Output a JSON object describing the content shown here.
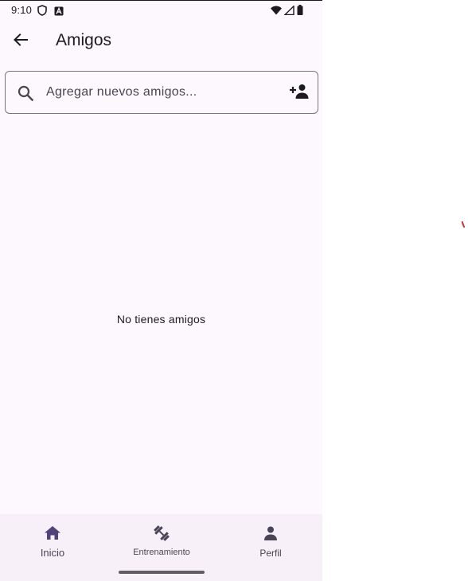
{
  "status_bar": {
    "time": "9:10",
    "left_icons": [
      "shield-icon",
      "a-badge-icon"
    ],
    "right_icons": [
      "wifi-icon",
      "signal-icon",
      "battery-icon"
    ]
  },
  "app_bar": {
    "title": "Amigos",
    "back_icon": "arrow-back-icon"
  },
  "search": {
    "placeholder": "Agregar nuevos amigos...",
    "value": "",
    "leading_icon": "search-icon",
    "trailing_icon": "person-add-icon"
  },
  "empty_state": {
    "message": "No tienes amigos"
  },
  "bottom_nav": {
    "items": [
      {
        "label": "Inicio",
        "icon": "home-icon",
        "active": true
      },
      {
        "label": "Entrenamiento",
        "icon": "dumbbell-icon",
        "active": false
      },
      {
        "label": "Perfil",
        "icon": "person-icon",
        "active": false
      }
    ]
  },
  "colors": {
    "background": "#fdf7fe",
    "text_primary": "#1c1b1f",
    "outline": "#79747e",
    "nav_background": "#f7f0f8",
    "active_icon": "#4f437a",
    "inactive_icon": "#4a4458"
  }
}
